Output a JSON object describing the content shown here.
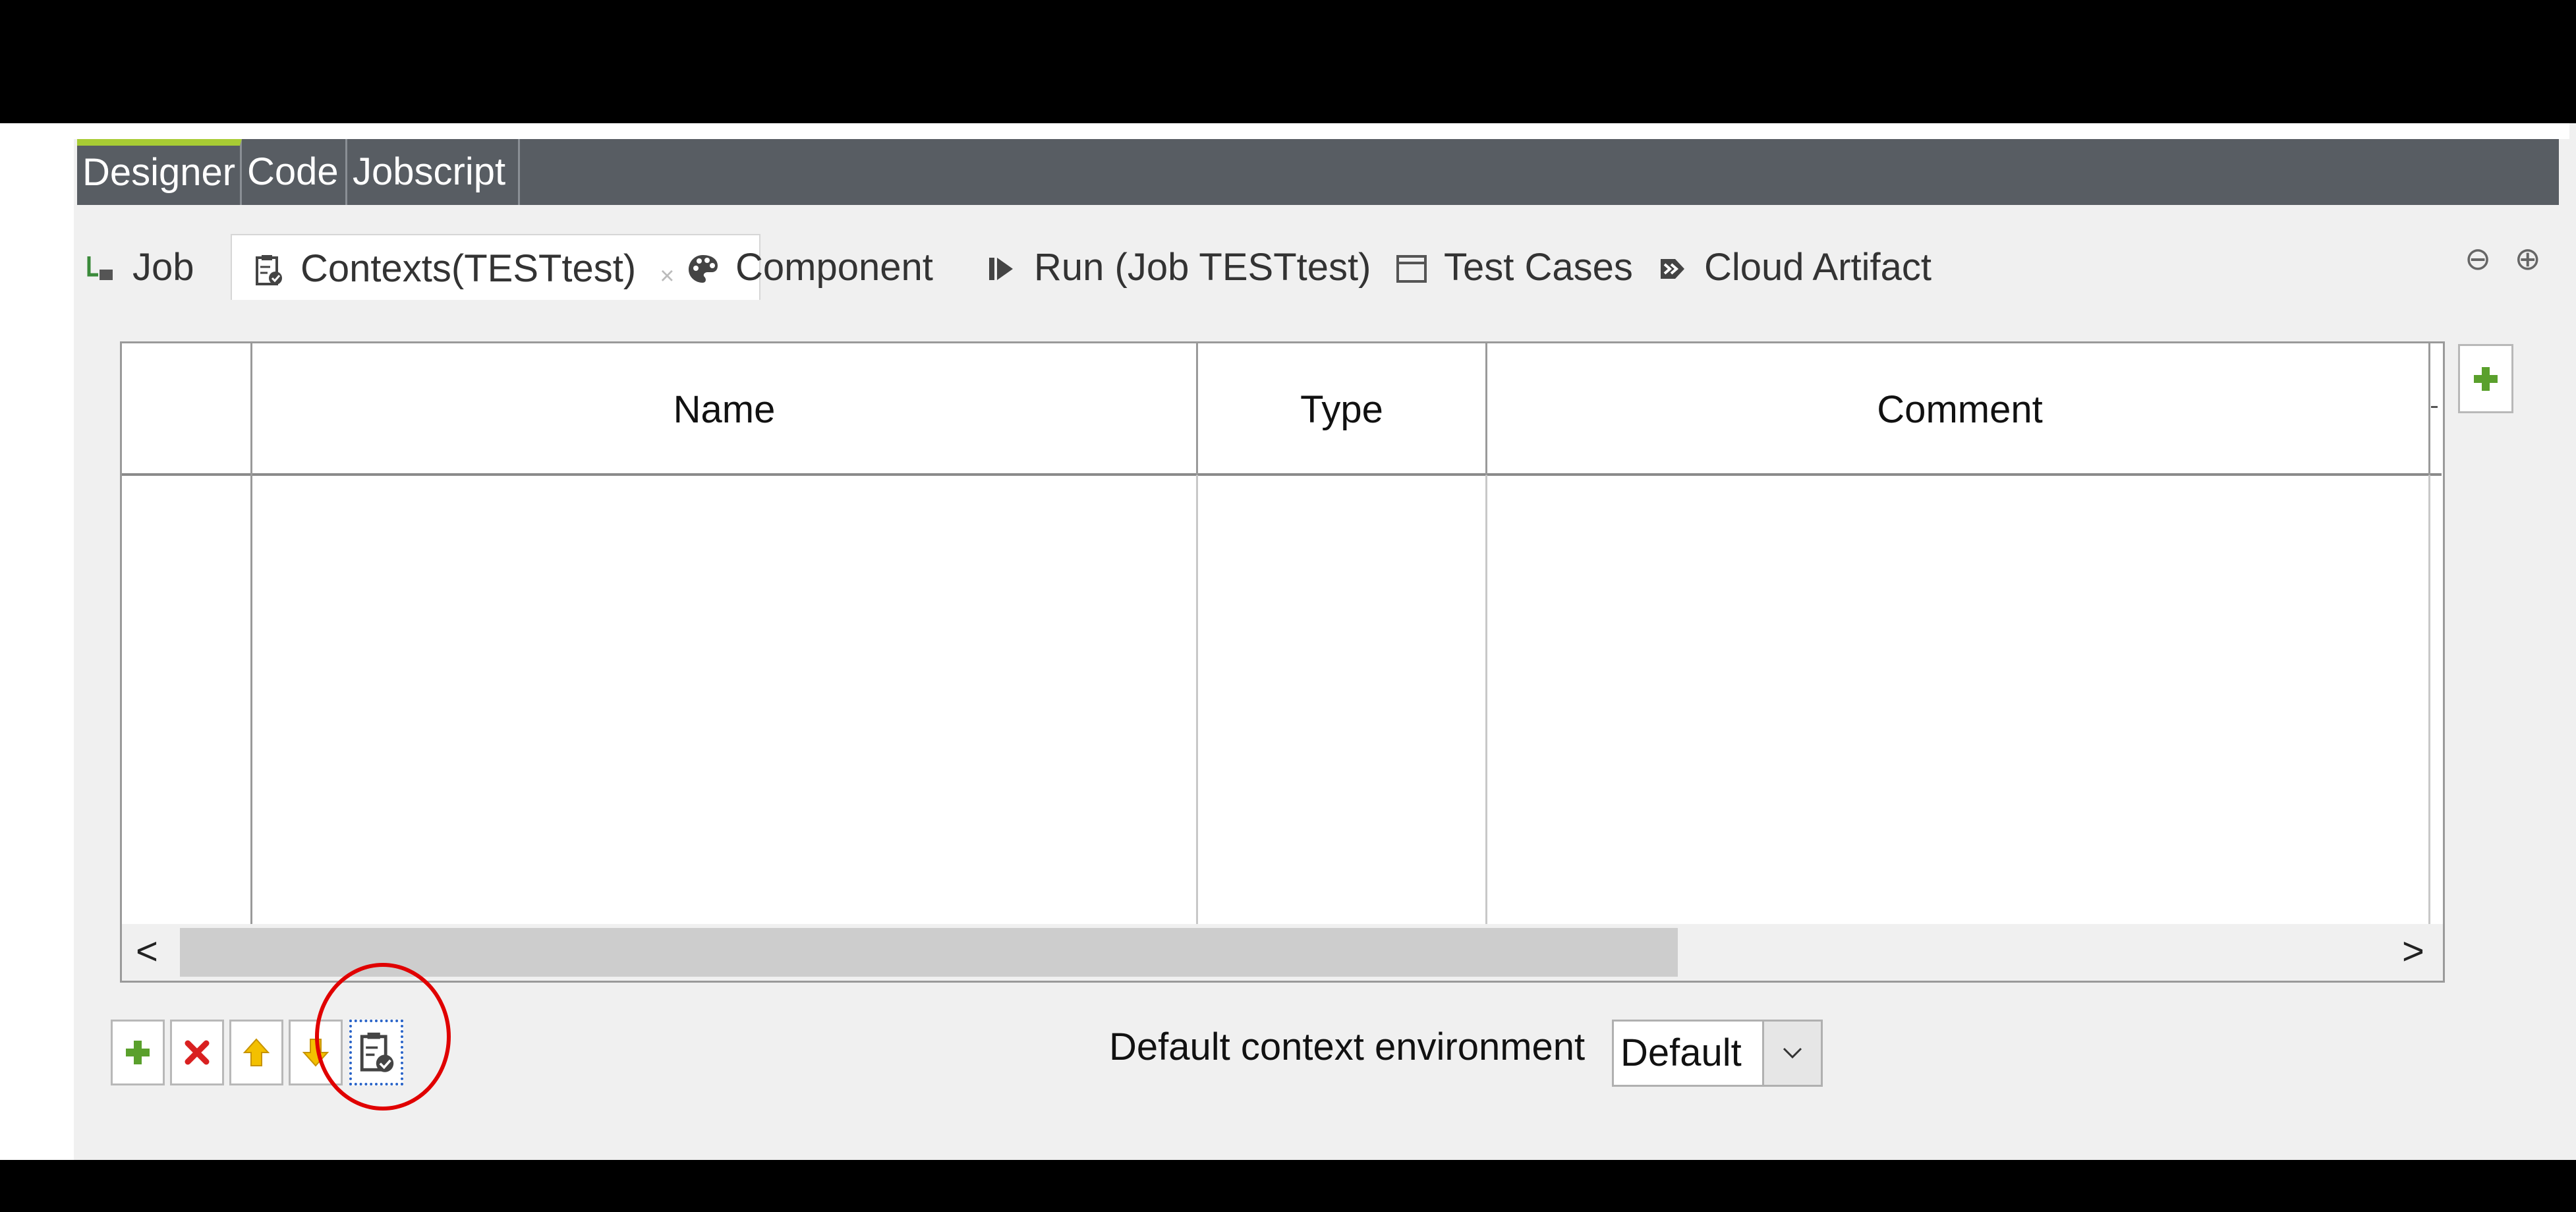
{
  "editor_tabs": [
    {
      "label": "Designer",
      "active": true
    },
    {
      "label": "Code",
      "active": false
    },
    {
      "label": "Jobscript",
      "active": false
    }
  ],
  "view_tabs": [
    {
      "label": "Job",
      "icon": "job-icon"
    },
    {
      "label": "Contexts(TESTtest)",
      "icon": "contexts-icon",
      "active": true,
      "close": "×"
    },
    {
      "label": "Component",
      "icon": "palette-icon"
    },
    {
      "label": "Run (Job TESTtest)",
      "icon": "run-icon"
    },
    {
      "label": "Test Cases",
      "icon": "test-cases-icon"
    },
    {
      "label": "Cloud Artifact",
      "icon": "cloud-artifact-icon"
    }
  ],
  "window_controls": {
    "minimize": "⊖",
    "maximize": "⊕"
  },
  "table": {
    "columns": [
      "",
      "Name",
      "Type",
      "Comment"
    ],
    "rows": []
  },
  "scroll": {
    "left": "<",
    "right": ">"
  },
  "toolbar": {
    "add_icon": "plus-icon",
    "remove_icon": "red-x-icon",
    "up_icon": "up-arrow-icon",
    "down_icon": "down-arrow-icon",
    "contexts_icon": "clipboard-check-icon"
  },
  "environment": {
    "label": "Default context environment",
    "value": "Default"
  },
  "colors": {
    "accent_green": "#a8cc34",
    "editor_bar": "#585d63",
    "highlight_red": "#e00000"
  }
}
